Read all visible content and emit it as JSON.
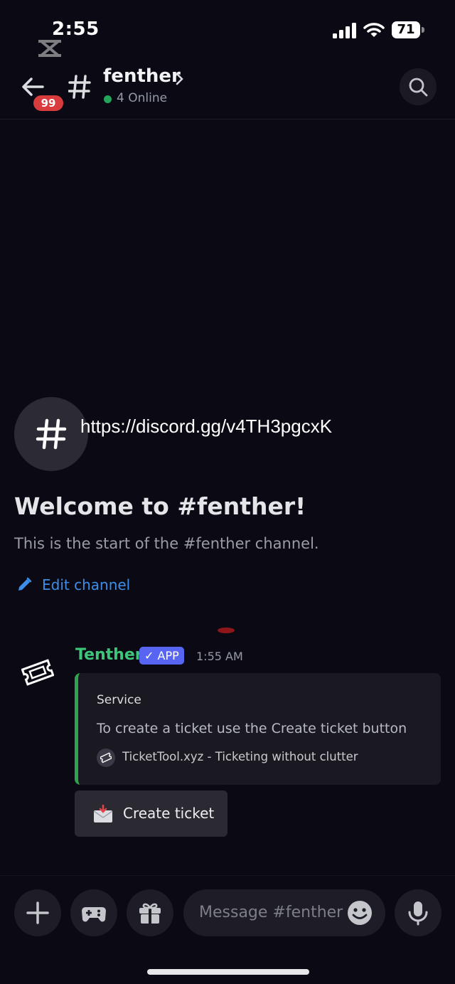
{
  "status_bar": {
    "time": "2:55",
    "battery": "71",
    "icons": [
      "capcut-icon",
      "signal-icon",
      "wifi-icon",
      "battery-icon"
    ]
  },
  "header": {
    "back_icon": "arrow-left-icon",
    "unread_badge": "99",
    "channel_icon": "hash-icon",
    "channel_name": "fenther",
    "online": "4 Online",
    "online_color": "#23a55a",
    "search_icon": "search-icon"
  },
  "welcome": {
    "invite_link": "https://discord.gg/v4TH3pgcxK",
    "title": "Welcome to #fenther!",
    "subtitle": "This is the start of the #fenther channel.",
    "edit_label": "Edit channel",
    "edit_icon": "pencil-icon"
  },
  "message": {
    "avatar_icon": "ticket-icon",
    "author": "Tenther",
    "author_color": "#3ec57a",
    "app_tag": "✓ APP",
    "timestamp": "1:55 AM",
    "embed": {
      "accent_color": "#2ea44f",
      "title": "Service",
      "description": "To create a ticket use the Create ticket button",
      "footer": "TicketTool.xyz - Ticketing without clutter"
    },
    "button_label": "Create ticket",
    "button_icon": "envelope-icon"
  },
  "composer": {
    "placeholder": "Message #fenther",
    "icons": [
      "plus-icon",
      "gamepad-icon",
      "gift-icon",
      "emoji-icon",
      "microphone-icon"
    ]
  }
}
